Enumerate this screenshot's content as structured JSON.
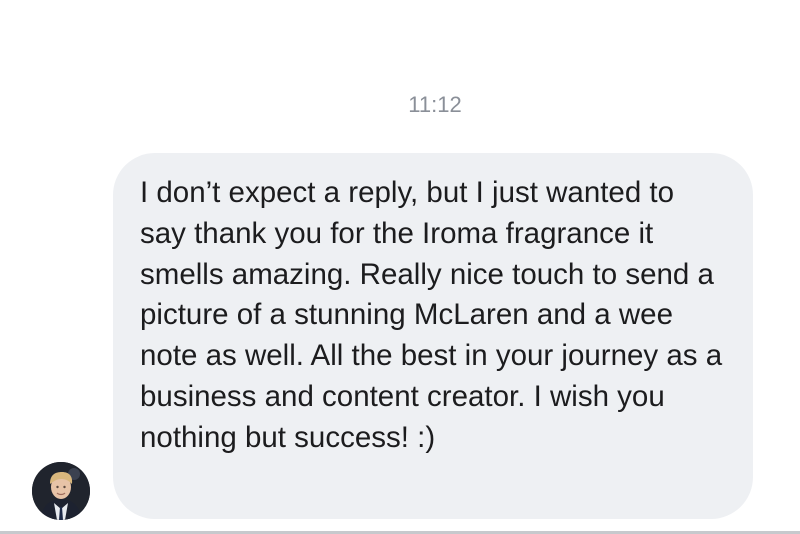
{
  "conversation": {
    "timestamp": "11:12",
    "messages": [
      {
        "direction": "incoming",
        "text": "I don’t expect a reply, but I just wanted to say thank you for the Iroma fragrance it smells amazing. Really nice touch to send a picture of a stunning McLaren and a wee note as well. All the best in your journey as a business and content creator. I wish you nothing but success! :)",
        "avatar_icon": "user-avatar"
      }
    ]
  }
}
